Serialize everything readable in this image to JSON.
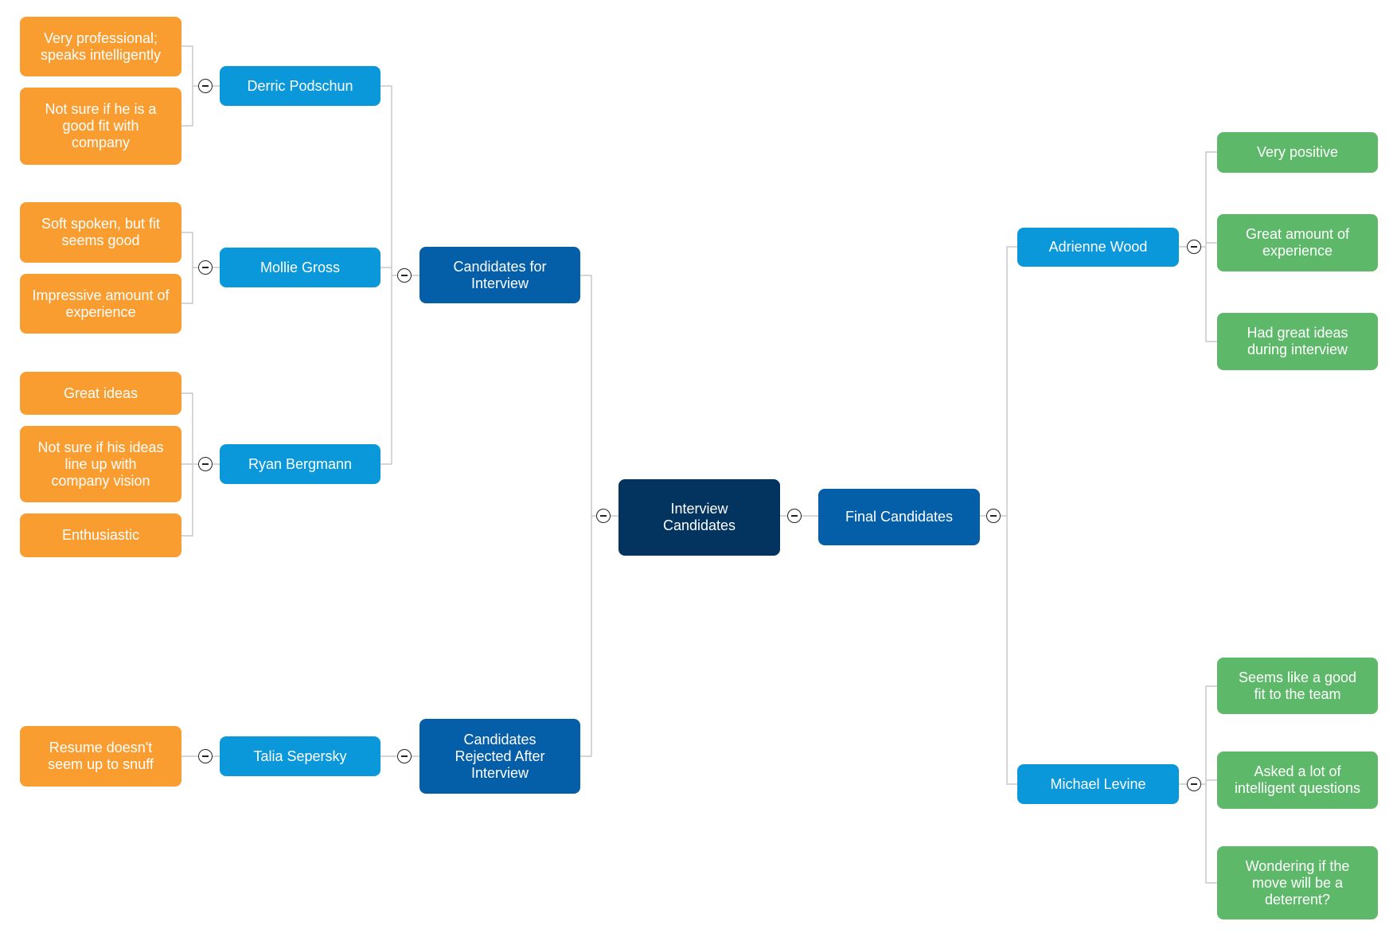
{
  "diagram": {
    "type": "mind-map",
    "root": {
      "label": "Interview Candidates",
      "color": "#03335f"
    },
    "branches": {
      "candidates_for_interview": {
        "label": "Candidates for Interview",
        "color": "#045ea8",
        "candidates": [
          {
            "name": "Derric Podschun",
            "notes": [
              "Very professional; speaks intelligently",
              "Not sure if he is a good fit with company"
            ]
          },
          {
            "name": "Mollie Gross",
            "notes": [
              "Soft spoken, but fit seems good",
              "Impressive amount of experience"
            ]
          },
          {
            "name": "Ryan Bergmann",
            "notes": [
              "Great ideas",
              "Not sure if his ideas line up with company vision",
              "Enthusiastic"
            ]
          }
        ]
      },
      "rejected_after_interview": {
        "label": "Candidates Rejected After Interview",
        "color": "#045ea8",
        "candidates": [
          {
            "name": "Talia Sepersky",
            "notes": [
              "Resume doesn't seem up to snuff"
            ]
          }
        ]
      },
      "final_candidates": {
        "label": "Final Candidates",
        "color": "#045ea8",
        "candidates": [
          {
            "name": "Adrienne Wood",
            "notes": [
              "Very positive",
              "Great amount of experience",
              "Had great ideas during interview"
            ]
          },
          {
            "name": "Michael Levine",
            "notes": [
              "Seems like a good fit to the team",
              "Asked a lot of intelligent questions",
              "Wondering if the move will be a deterrent?"
            ]
          }
        ]
      }
    },
    "colors": {
      "candidate_node": "#0a98db",
      "negative_notes": "#f99d31",
      "positive_notes": "#5db86a",
      "connector": "#c8c8c8"
    },
    "toggle_icon": "collapse-minus-icon"
  }
}
